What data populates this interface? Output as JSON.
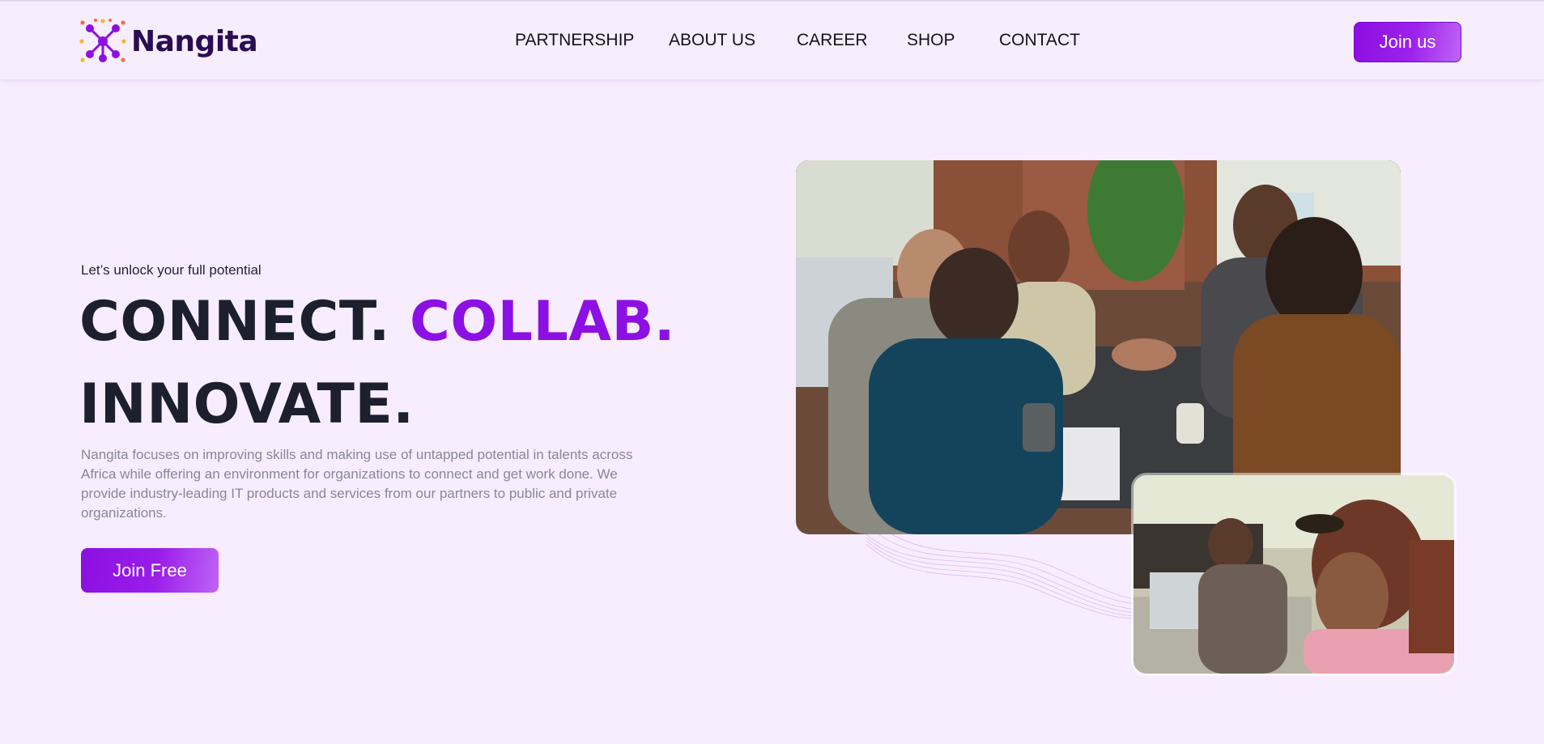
{
  "header": {
    "logo": {
      "name": "Nangita",
      "icon": "molecule-icon"
    },
    "nav": [
      {
        "label": "PARTNERSHIP"
      },
      {
        "label": "ABOUT US"
      },
      {
        "label": "CAREER"
      },
      {
        "label": "SHOP"
      },
      {
        "label": "CONTACT"
      }
    ],
    "join_label": "Join us"
  },
  "hero": {
    "tagline": "Let’s unlock your full potential",
    "headline_part1": "CONNECT.",
    "headline_part2": "COLLAB.",
    "headline_part3": "INNOVATE.",
    "description": "Nangita focuses on improving skills and making use of untapped potential in talents across Africa while offering an environment for organizations to connect and get work done. We provide industry-leading IT products and services from our partners to public and private organizations.",
    "cta_label": "Join Free"
  },
  "colors": {
    "accent": "#8c10e3",
    "background": "#f7edff",
    "heading": "#1c1f2e",
    "logo_text": "#2a0c52"
  }
}
